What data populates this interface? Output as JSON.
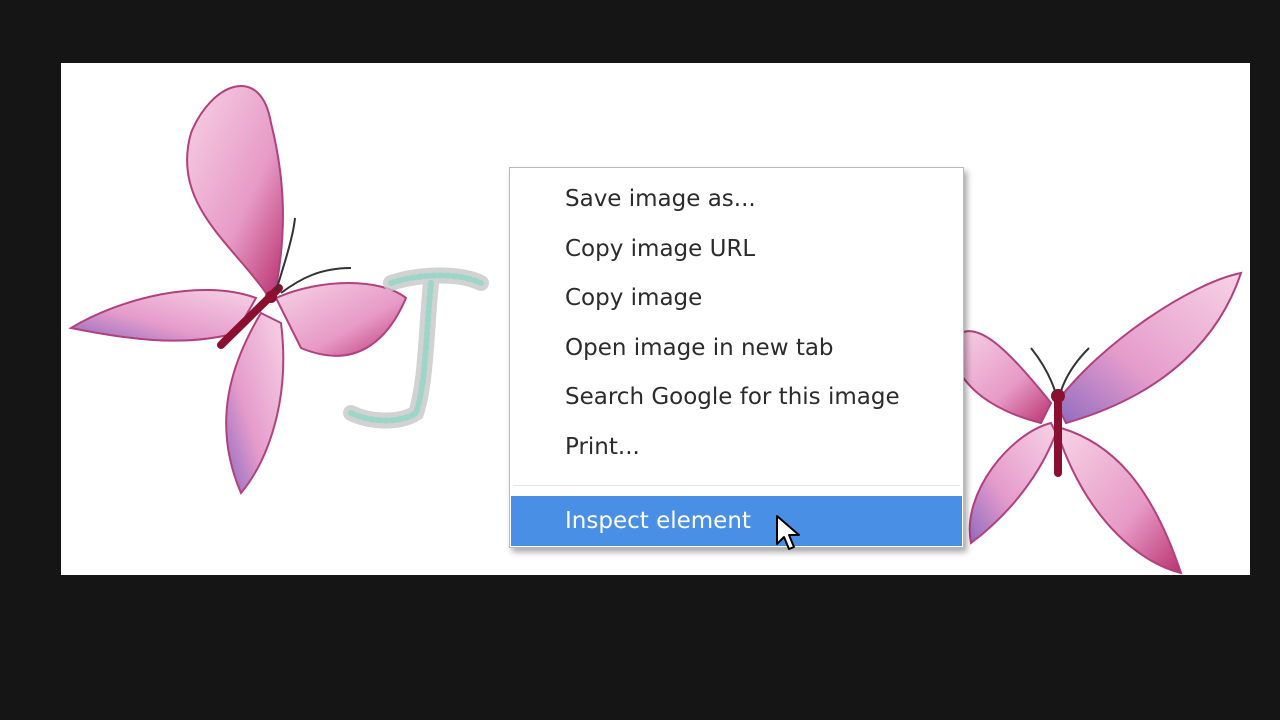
{
  "context_menu": {
    "items": [
      {
        "label": "Save image as..."
      },
      {
        "label": "Copy image URL"
      },
      {
        "label": "Copy image"
      },
      {
        "label": "Open image in new tab"
      },
      {
        "label": "Search Google for this image"
      },
      {
        "label": "Print..."
      }
    ],
    "highlighted_item": {
      "label": "Inspect element"
    }
  },
  "colors": {
    "background": "#151515",
    "highlight": "#4a8fe6",
    "butterfly_wing": "#e48ac0"
  }
}
